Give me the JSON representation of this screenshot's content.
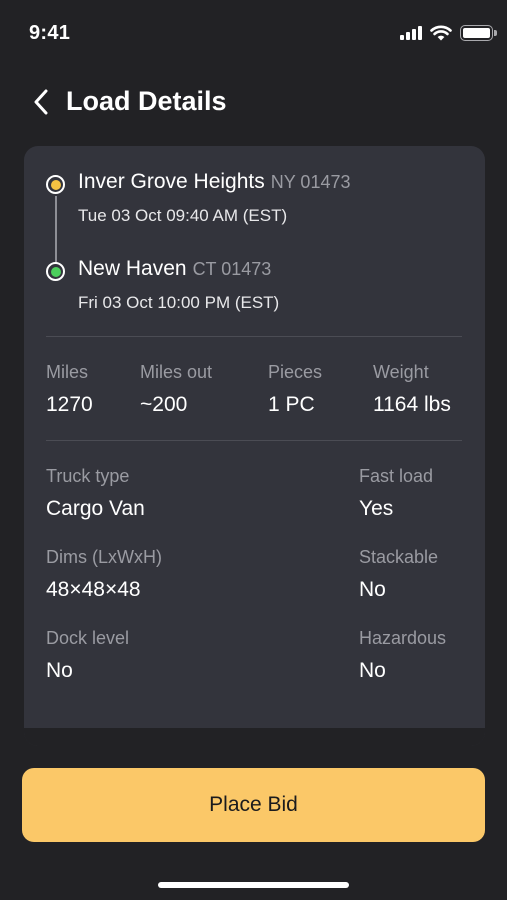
{
  "status_bar": {
    "time": "9:41",
    "icons": [
      "signal-icon",
      "wifi-icon",
      "battery-icon"
    ],
    "battery_level": 1.0
  },
  "header": {
    "back_icon": "chevron-left-icon",
    "title": "Load Details"
  },
  "route": {
    "pickup": {
      "city": "Inver Grove Heights",
      "state_zip": "NY 01473",
      "datetime": "Tue 03 Oct 09:40 AM (EST)",
      "marker_color": "#f5c342"
    },
    "dropoff": {
      "city": "New Haven",
      "state_zip": "CT 01473",
      "datetime": "Fri 03 Oct 10:00 PM (EST)",
      "marker_color": "#4ccf5c"
    }
  },
  "stats": {
    "miles": {
      "label": "Miles",
      "value": "1270"
    },
    "miles_out": {
      "label": "Miles out",
      "value": "~200"
    },
    "pieces": {
      "label": "Pieces",
      "value": "1 PC"
    },
    "weight": {
      "label": "Weight",
      "value": "1164 lbs"
    }
  },
  "details": {
    "truck_type": {
      "label": "Truck type",
      "value": "Cargo Van"
    },
    "fast_load": {
      "label": "Fast load",
      "value": "Yes"
    },
    "dims": {
      "label": "Dims (LxWxH)",
      "value": "48×48×48"
    },
    "stackable": {
      "label": "Stackable",
      "value": "No"
    },
    "dock_level": {
      "label": "Dock level",
      "value": "No"
    },
    "hazardous": {
      "label": "Hazardous",
      "value": "No"
    }
  },
  "actions": {
    "place_bid_label": "Place Bid"
  },
  "colors": {
    "background": "#222225",
    "card": "#33343c",
    "accent": "#fbc868",
    "muted_text": "#9a9ba2"
  }
}
